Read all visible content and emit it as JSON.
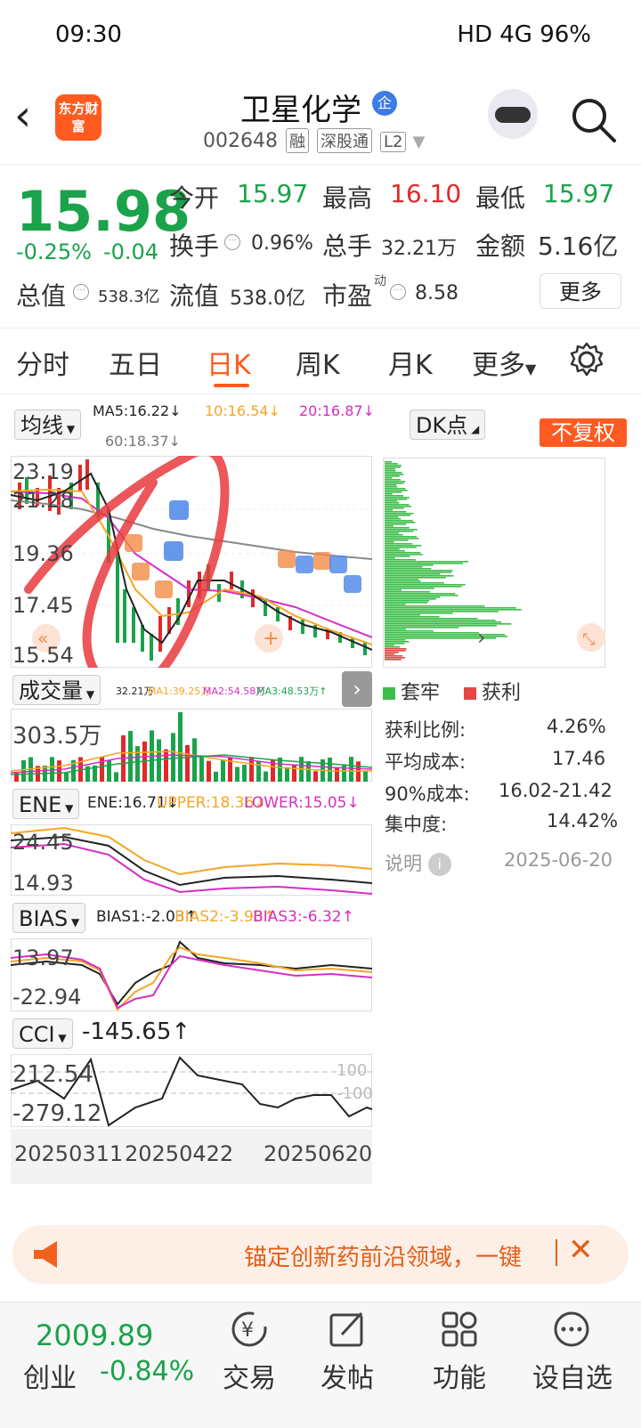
{
  "status_bar": {
    "time": "09:30",
    "right_text": "HD 4G 96%"
  },
  "header": {
    "logo_text": "东方财富",
    "title": "卫星化学",
    "qi_badge": "企",
    "code": "002648",
    "tags": [
      "融",
      "深股通",
      "L2"
    ]
  },
  "quote": {
    "price": "15.98",
    "change_pct": "-0.25%",
    "change_abs": "-0.04",
    "open_label": "今开",
    "open": "15.97",
    "high_label": "最高",
    "high": "16.10",
    "low_label": "最低",
    "low": "15.97",
    "turnover_label": "换手",
    "turnover": "0.96%",
    "volume_label": "总手",
    "volume": "32.21万",
    "amount_label": "金额",
    "amount": "5.16亿",
    "mktcap_label": "总值",
    "mktcap": "538.3亿",
    "float_label": "流值",
    "float": "538.0亿",
    "pe_label": "市盈",
    "pe_sup": "动",
    "pe": "8.58",
    "more_label": "更多"
  },
  "tabs": [
    "分时",
    "五日",
    "日K",
    "周K",
    "月K",
    "更多"
  ],
  "chart": {
    "ma_select": "均线",
    "ma5": "MA5:16.22↓",
    "ma10": "10:16.54↓",
    "ma20": "20:16.87↓",
    "ma60": "60:18.37↓",
    "dk_label": "DK点",
    "fuquan_label": "不复权",
    "price_ticks": [
      "23.19",
      "21.28",
      "19.36",
      "17.45",
      "15.54"
    ],
    "vol_select": "成交量",
    "vol_ma": "32.21万",
    "vol_ma1": "MA1:39.25万",
    "vol_ma2": "MA2:54.58万",
    "vol_ma3": "MA3:48.53万↑",
    "vol_tick": "303.5万",
    "ene_select": "ENE",
    "ene_val": "ENE:16.71↓",
    "ene_upper": "UPPER:18.36↓",
    "ene_lower": "LOWER:15.05↓",
    "ene_ticks": [
      "24.45",
      "14.93"
    ],
    "bias_select": "BIAS",
    "bias1": "BIAS1:-2.03↑",
    "bias2": "BIAS2:-3.90↑",
    "bias3": "BIAS3:-6.32↑",
    "bias_ticks": [
      "13.97",
      "-22.94"
    ],
    "cci_select": "CCI",
    "cci_val": "-145.65↑",
    "cci_ticks": [
      "212.54",
      "-279.12"
    ],
    "cci_ref": [
      "100",
      "-100"
    ],
    "dates": [
      "20250311",
      "20250422",
      "20250620"
    ]
  },
  "chip": {
    "legend_trapped": "套牢",
    "legend_profit": "获利",
    "profit_ratio_label": "获利比例:",
    "profit_ratio": "4.26%",
    "avg_cost_label": "平均成本:",
    "avg_cost": "17.46",
    "cost90_label": "90%成本:",
    "cost90": "16.02-21.42",
    "concentration_label": "集中度:",
    "concentration": "14.42%",
    "note_label": "说明",
    "date": "2025-06-20"
  },
  "banner": {
    "text": "锚定创新药前沿领域，一键"
  },
  "bottom": {
    "index_value": "2009.89",
    "index_name": "创业",
    "index_change": "-0.84%",
    "items": [
      "交易",
      "发帖",
      "功能",
      "设自选"
    ]
  },
  "colors": {
    "up": "#e02a2a",
    "down": "#1aa34a",
    "accent": "#ff5a1f",
    "ma5": "#222222",
    "ma10": "#f5a623",
    "ma20": "#d62ec4",
    "ma60": "#888888"
  }
}
